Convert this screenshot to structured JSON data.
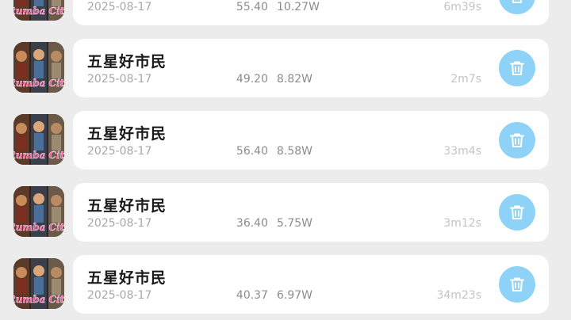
{
  "records": [
    {
      "title": "",
      "date": "2025-08-17",
      "score": "55.40",
      "views": "10.27W",
      "duration": "6m39s",
      "delete_icon": "trash-icon"
    },
    {
      "title": "五星好市民",
      "date": "2025-08-17",
      "score": "49.20",
      "views": "8.82W",
      "duration": "2m7s",
      "delete_icon": "trash-icon"
    },
    {
      "title": "五星好市民",
      "date": "2025-08-17",
      "score": "56.40",
      "views": "8.58W",
      "duration": "33m4s",
      "delete_icon": "trash-icon"
    },
    {
      "title": "五星好市民",
      "date": "2025-08-17",
      "score": "36.40",
      "views": "5.75W",
      "duration": "3m12s",
      "delete_icon": "trash-icon"
    },
    {
      "title": "五星好市民",
      "date": "2025-08-17",
      "score": "40.37",
      "views": "6.97W",
      "duration": "34m23s",
      "delete_icon": "trash-icon"
    }
  ],
  "app_icon_text": "Rumba City",
  "colors": {
    "background": "#ececec",
    "card": "#ffffff",
    "delete_button": "#8fd2f7",
    "title_text": "#1a1a1a",
    "meta_text": "#a8a8a8"
  }
}
